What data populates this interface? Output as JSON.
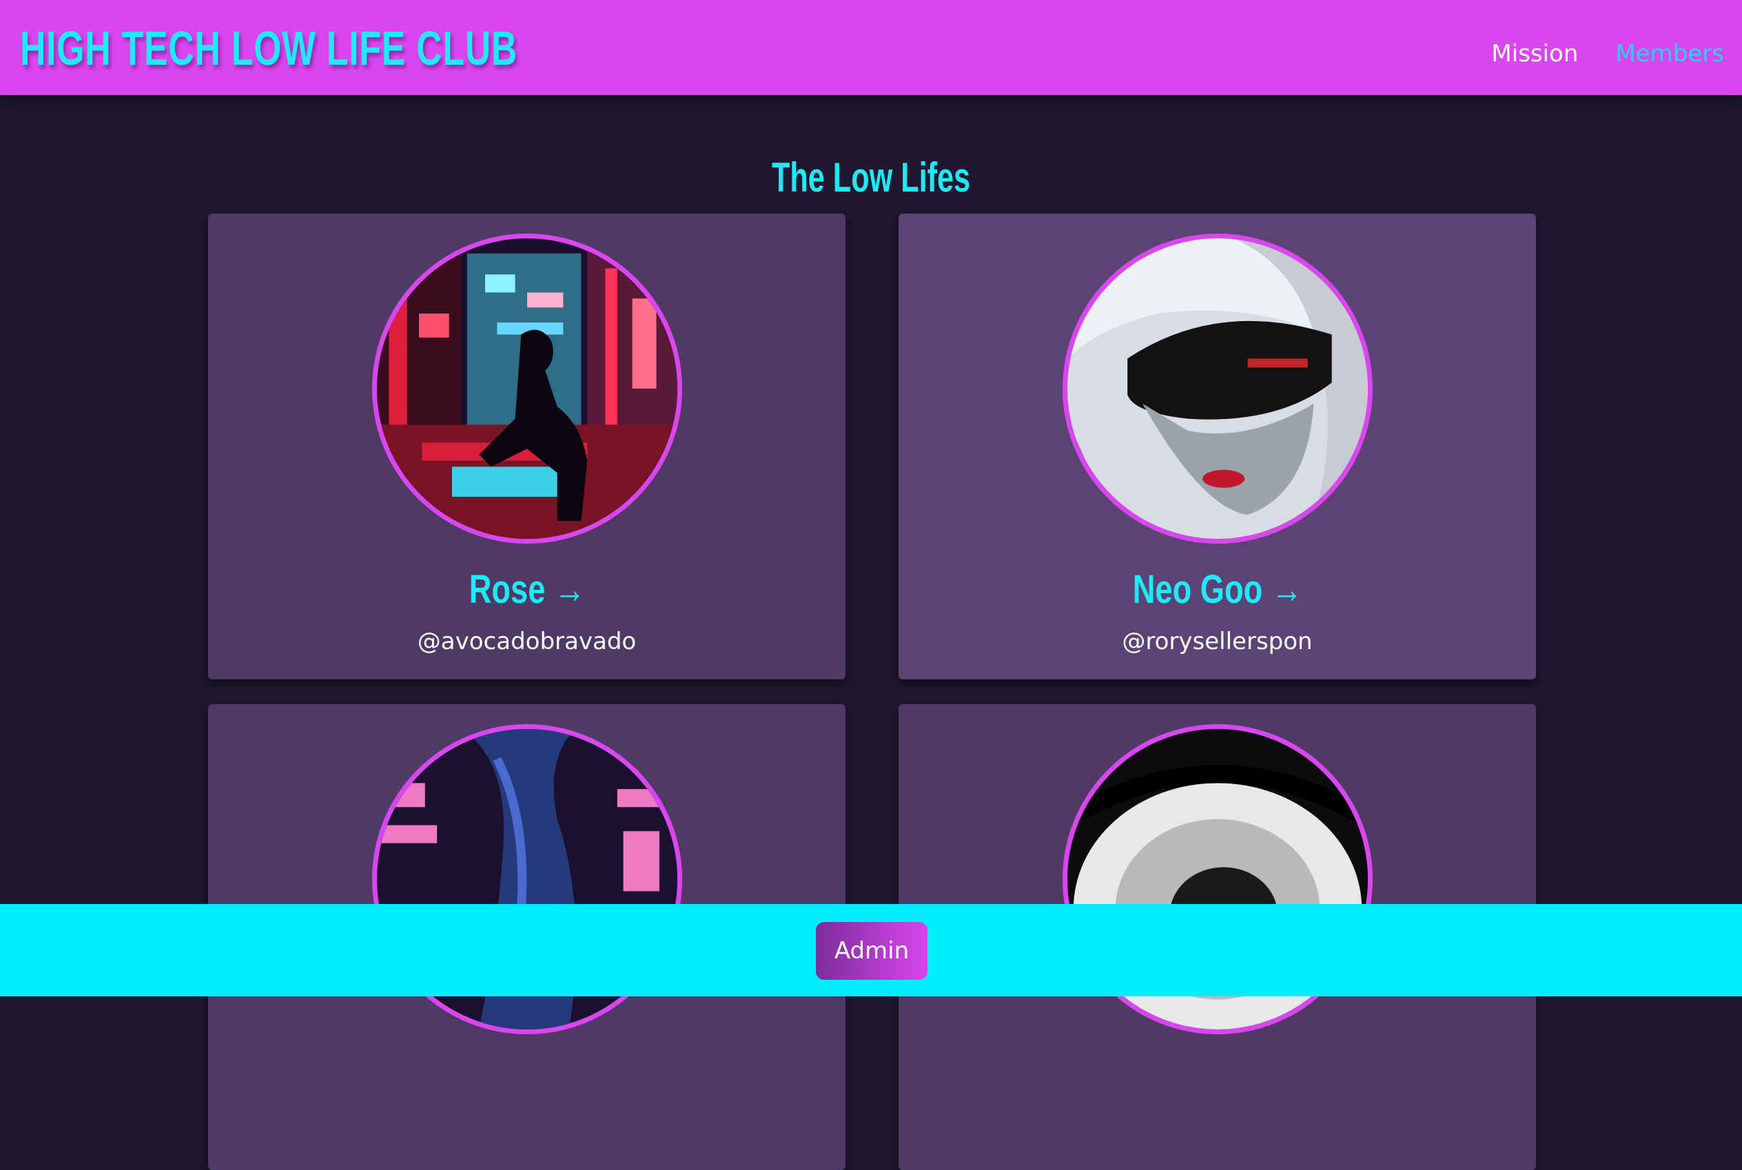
{
  "header": {
    "brand": "HIGH TECH LOW LIFE CLUB",
    "nav": [
      {
        "label": "Mission"
      },
      {
        "label": "Members"
      }
    ]
  },
  "main": {
    "title": "The Low Lifes",
    "members": [
      {
        "name": "Rose →",
        "handle": "@avocadobravado",
        "avatar": "city-night-silhouette-image"
      },
      {
        "name": "Neo Goo →",
        "handle": "@rorysellerspon",
        "avatar": "visor-woman-image"
      },
      {
        "name": "",
        "handle": "",
        "avatar": "rain-figure-image"
      },
      {
        "name": "",
        "handle": "",
        "avatar": "eye-closeup-image"
      }
    ]
  },
  "footer": {
    "admin_label": "Admin"
  },
  "colors": {
    "header_bg": "#d946ef",
    "accent_cyan": "#1de9f7",
    "page_bg": "#1f1830",
    "card_bg": "#4f3a66",
    "footer_bg": "#00eefb"
  }
}
